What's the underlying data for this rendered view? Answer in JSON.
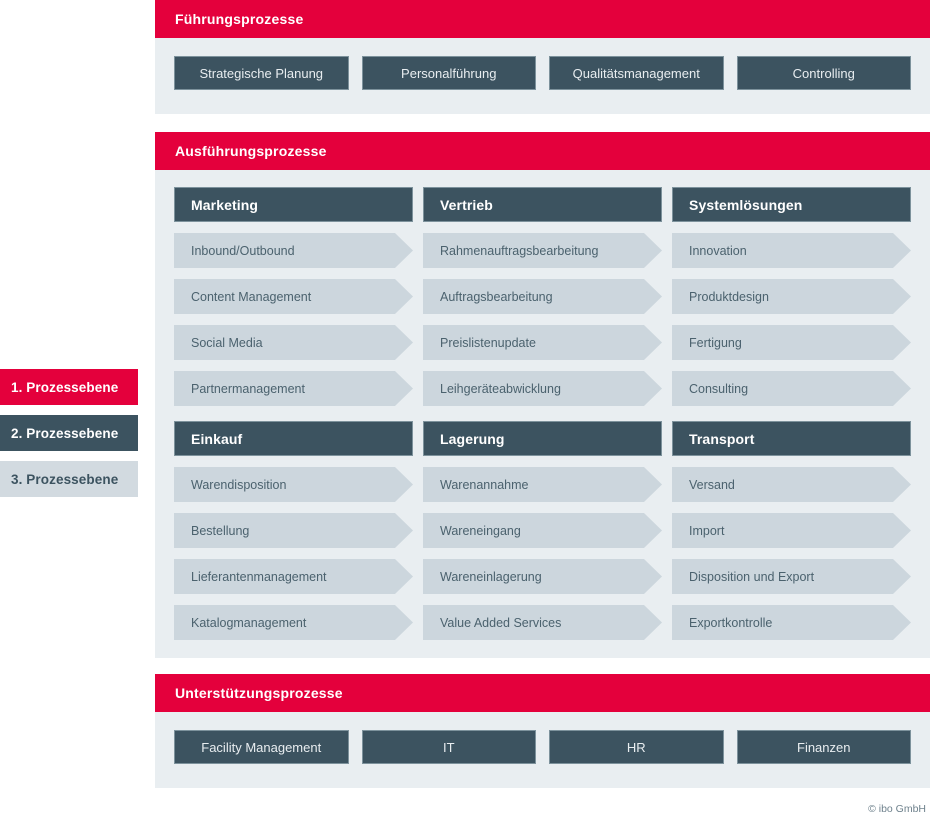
{
  "legend": {
    "items": [
      {
        "label": "1. Prozessebene",
        "level": 1
      },
      {
        "label": "2. Prozessebene",
        "level": 2
      },
      {
        "label": "3. Prozessebene",
        "level": 3
      }
    ]
  },
  "bands": {
    "leadership": {
      "title": "Führungsprozesse",
      "boxes": [
        "Strategische Planung",
        "Personalführung",
        "Qualitätsmanagement",
        "Controlling"
      ]
    },
    "execution": {
      "title": "Ausführungsprozesse",
      "rows": [
        [
          {
            "title": "Marketing",
            "steps": [
              "Inbound/Outbound",
              "Content Management",
              "Social Media",
              "Partnermanagement"
            ]
          },
          {
            "title": "Vertrieb",
            "steps": [
              "Rahmenauftragsbearbeitung",
              "Auftragsbearbeitung",
              "Preislistenupdate",
              "Leihgeräteabwicklung"
            ]
          },
          {
            "title": "Systemlösungen",
            "steps": [
              "Innovation",
              "Produktdesign",
              "Fertigung",
              "Consulting"
            ]
          }
        ],
        [
          {
            "title": "Einkauf",
            "steps": [
              "Warendisposition",
              "Bestellung",
              "Lieferantenmanagement",
              "Katalogmanagement"
            ]
          },
          {
            "title": "Lagerung",
            "steps": [
              "Warenannahme",
              "Wareneingang",
              "Wareneinlagerung",
              "Value Added Services"
            ]
          },
          {
            "title": "Transport",
            "steps": [
              "Versand",
              "Import",
              "Disposition und Export",
              "Exportkontrolle"
            ]
          }
        ]
      ]
    },
    "support": {
      "title": "Unterstützungsprozesse",
      "boxes": [
        "Facility Management",
        "IT",
        "HR",
        "Finanzen"
      ]
    }
  },
  "footer": {
    "copyright": "© ibo GmbH"
  },
  "colors": {
    "accent_red": "#e4003c",
    "dark_slate": "#3c5360",
    "step_fill": "#ccd6dd",
    "panel_bg": "#e9eef1",
    "legend_level3": "#d2dae0"
  }
}
